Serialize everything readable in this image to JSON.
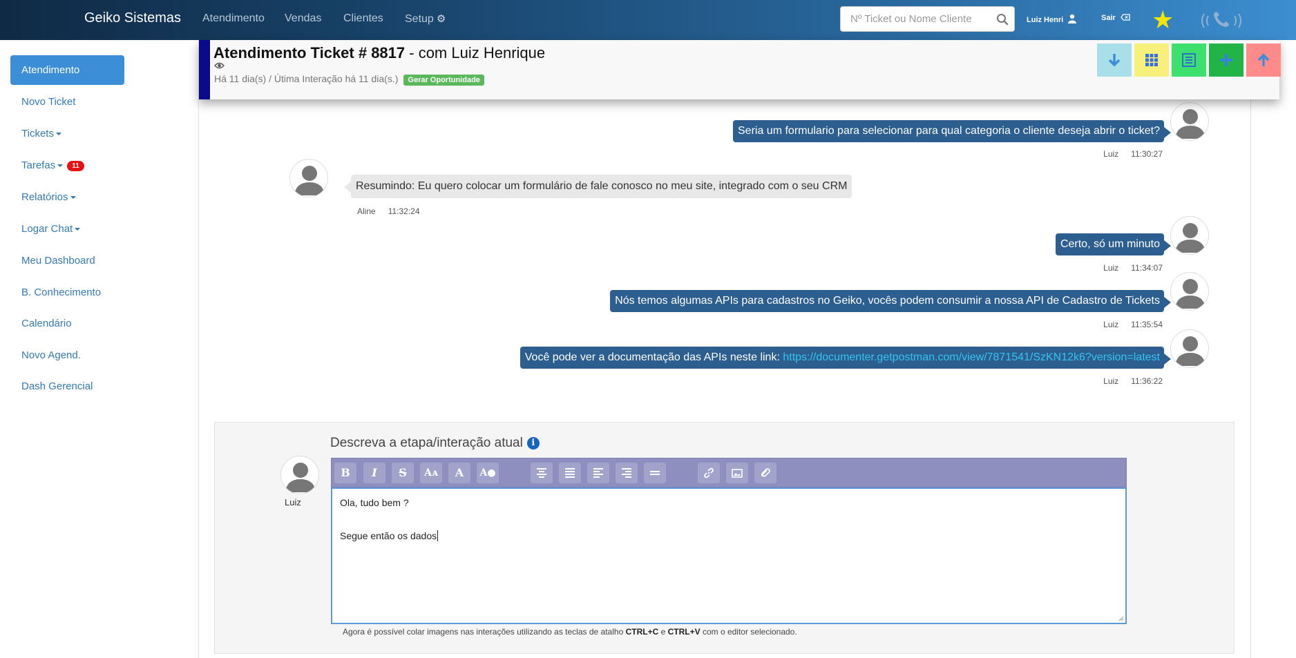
{
  "navbar": {
    "brand": "Geiko Sistemas",
    "links": [
      "Atendimento",
      "Vendas",
      "Clientes",
      "Setup"
    ],
    "search_placeholder": "Nº Ticket ou Nome Cliente",
    "user_label": "Luiz Henri",
    "logout_label": "Sair"
  },
  "sidebar": {
    "active": "Atendimento",
    "items": [
      "Novo Ticket",
      "Tickets",
      "Tarefas",
      "Relatórios",
      "Logar Chat",
      "Meu Dashboard",
      "B. Conhecimento",
      "Calendário",
      "Novo Agend.",
      "Dash Gerencial"
    ],
    "tarefas_badge": "11"
  },
  "ticket": {
    "title_prefix": "Atendimento Ticket # 8817",
    "title_suffix": " - com Luiz Henrique",
    "subtitle": "Há 11 dia(s) / Útima Interação há 11 dia(s.)",
    "opportunity_label": "Gerar Oportunidade"
  },
  "messages": [
    {
      "author": "Luiz",
      "time": "11:30:27",
      "text": "Seria um formulario para selecionar para qual categoria o cliente deseja abrir o ticket?"
    },
    {
      "author": "Aline",
      "time": "11:32:24",
      "text": "Resumindo: Eu quero colocar um formulário de fale conosco no meu site, integrado com o seu CRM"
    },
    {
      "author": "Luiz",
      "time": "11:34:07",
      "text": "Certo, só um minuto"
    },
    {
      "author": "Luiz",
      "time": "11:35:54",
      "text": "Nós temos algumas APIs para cadastros no Geiko, vocês podem consumir a nossa API de Cadastro de Tickets"
    },
    {
      "author": "Luiz",
      "time": "11:36:22",
      "text": "Você pode ver a documentação das APIs neste link: ",
      "link": "https://documenter.getpostman.com/view/7871541/SzKN12k6?version=latest"
    }
  ],
  "compose": {
    "label": "Descreva a etapa/interação atual",
    "user": "Luiz",
    "lines": [
      "Ola,  tudo bem ?",
      "",
      "Segue então os dados"
    ],
    "hint_a": "Agora é possível colar imagens nas interações utilizando as teclas de atalho ",
    "hint_ctrl_c": "CTRL+C",
    "hint_and": " e ",
    "hint_ctrl_v": "CTRL+V",
    "hint_b": " com o editor selecionado."
  },
  "toolbar_buttons": [
    "bold",
    "italic",
    "strikethrough",
    "font-size",
    "font-color",
    "background-color",
    "align-center",
    "justify",
    "align-left",
    "align-right",
    "horizontal-rule",
    "link",
    "image",
    "attachment"
  ],
  "colors": {
    "header_btn_download": "#a8dfe8",
    "header_btn_grid": "#f7f07a",
    "header_btn_list": "#3de06c",
    "header_btn_add": "#22b447",
    "header_btn_up": "#ff8a8a",
    "bubble_out": "#2c5f8f",
    "accent": "#3c8ed6"
  }
}
